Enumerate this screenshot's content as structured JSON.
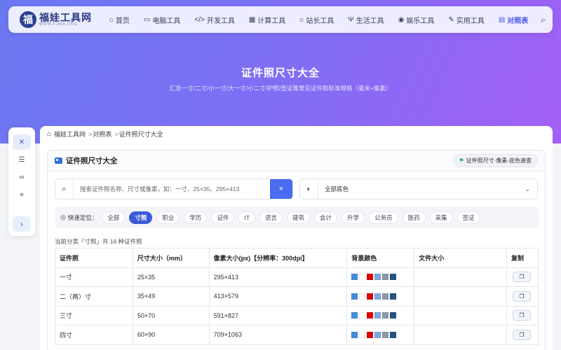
{
  "brand": {
    "logo_char": "福",
    "name": "福娃工具网",
    "url": "WWW.FUWA.ORG"
  },
  "nav": {
    "items": [
      {
        "icon": "⌂",
        "label": "首页"
      },
      {
        "icon": "▭",
        "label": "电脑工具"
      },
      {
        "icon": "</>",
        "label": "开发工具"
      },
      {
        "icon": "▦",
        "label": "计算工具"
      },
      {
        "icon": "⌂",
        "label": "站长工具"
      },
      {
        "icon": "Ψ",
        "label": "生活工具"
      },
      {
        "icon": "◉",
        "label": "娱乐工具"
      },
      {
        "icon": "✎",
        "label": "实用工具"
      },
      {
        "icon": "▤",
        "label": "对照表"
      }
    ],
    "search_icon": "⌕"
  },
  "hero": {
    "title": "证件照尺寸大全",
    "subtitle": "汇总一寸/二寸/小一寸/大一寸/小二寸/护照/签证等常见证件照标准规格（毫米+像素）"
  },
  "side": {
    "icons": [
      "✕",
      "☰",
      "∞",
      "⋄"
    ],
    "expand": "›"
  },
  "breadcrumb": {
    "home": "福娃工具网",
    "sep1": ">",
    "level1": "对照表",
    "sep2": ">",
    "current": "证件照尺寸大全"
  },
  "card": {
    "title": "证件照尺寸大全",
    "badge": "证件照尺寸·像素·底色速查",
    "badge_icon": "⚑"
  },
  "search": {
    "icon": "⌕",
    "placeholder": "搜索证件照名称、尺寸或像素，如：一寸、25×35、295×413",
    "clear": "×"
  },
  "bg_select": {
    "icon": "◐",
    "value": "全部底色",
    "chevron": "⌄"
  },
  "filter": {
    "icon": "◎",
    "label": "快速定位：",
    "chips": [
      "全部",
      "寸照",
      "职业",
      "学历",
      "证件",
      "IT",
      "语言",
      "建筑",
      "会计",
      "升学",
      "公务员",
      "医药",
      "采集",
      "签证"
    ],
    "active": "寸照"
  },
  "count_text": "当前分类「寸照」共 16 种证件照",
  "table": {
    "headers": [
      "证件照",
      "尺寸大小（mm）",
      "像素大小(px)【分辨率：300dpi】",
      "背景颜色",
      "文件大小",
      "复制"
    ],
    "rows": [
      {
        "name": "一寸",
        "mm": "25×35",
        "px": "295×413",
        "size": ""
      },
      {
        "name": "二（两）寸",
        "mm": "35×49",
        "px": "413×579",
        "size": ""
      },
      {
        "name": "三寸",
        "mm": "50×70",
        "px": "591×827",
        "size": ""
      },
      {
        "name": "四寸",
        "mm": "60×90",
        "px": "709×1063",
        "size": ""
      }
    ],
    "swatch_colors": [
      "#438edb",
      "#ffffff",
      "#e00000",
      "#7aa9e6",
      "#8f9aa8",
      "#25527f"
    ],
    "copy_icon": "❐"
  }
}
